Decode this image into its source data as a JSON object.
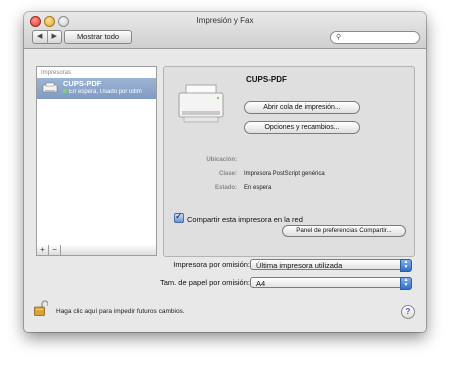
{
  "window": {
    "title": "Impresión y Fax"
  },
  "toolbar": {
    "back": "◀",
    "forward": "▶",
    "show_all": "Mostrar todo",
    "search_placeholder": ""
  },
  "printer_list": {
    "header": "Impresoras",
    "items": [
      {
        "name": "CUPS-PDF",
        "status": "En espera, Usado por últim"
      }
    ],
    "add": "+",
    "remove": "−"
  },
  "detail": {
    "name": "CUPS-PDF",
    "open_queue": "Abrir cola de impresión...",
    "options": "Opciones y recambios...",
    "location_label": "Ubicación:",
    "location": "",
    "class_label": "Clase:",
    "class": "Impresora PostScript genérica",
    "state_label": "Estado:",
    "state": "En espera",
    "share_label": "Compartir esta impresora en la red",
    "share_checked": true,
    "share_prefs": "Panel de preferencias Compartir..."
  },
  "defaults": {
    "printer_label": "Impresora por omisión:",
    "printer_value": "Última impresora utilizada",
    "paper_label": "Tam. de papel por omisión:",
    "paper_value": "A4"
  },
  "footer": {
    "lock_text": "Haga clic aquí para impedir futuros cambios.",
    "help": "?"
  }
}
